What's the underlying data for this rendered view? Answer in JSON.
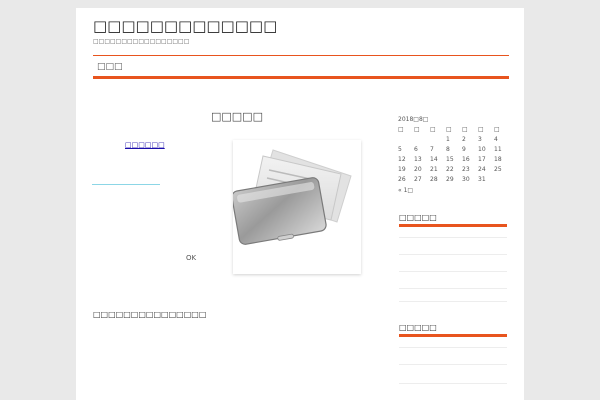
{
  "header": {
    "site_title": "□□□□□□□□□□□□□",
    "site_description": "□□□□□□□□□□□□□□□□□"
  },
  "nav": {
    "items": [
      {
        "label": "□□□"
      }
    ]
  },
  "main": {
    "post_title": "□□□□□",
    "link_text": "□□□□□□",
    "ok_text": "OK",
    "body_text": "□□□□□□□□□□□□□□□"
  },
  "sidebar": {
    "calendar": {
      "caption": "2018□8□",
      "weekdays": [
        "□",
        "□",
        "□",
        "□",
        "□",
        "□",
        "□"
      ],
      "weeks": [
        [
          "",
          "",
          "",
          "1",
          "2",
          "3",
          "4"
        ],
        [
          "5",
          "6",
          "7",
          "8",
          "9",
          "10",
          "11"
        ],
        [
          "12",
          "13",
          "14",
          "15",
          "16",
          "17",
          "18"
        ],
        [
          "19",
          "20",
          "21",
          "22",
          "23",
          "24",
          "25"
        ],
        [
          "26",
          "27",
          "28",
          "29",
          "30",
          "31",
          ""
        ]
      ],
      "prev_link": "« 1□"
    },
    "widgets": [
      {
        "title": "□□□□□"
      },
      {
        "title": "□□□□□"
      }
    ]
  },
  "colors": {
    "accent": "#e8541e",
    "background": "#e9e9e9",
    "link": "#1a0dab"
  }
}
